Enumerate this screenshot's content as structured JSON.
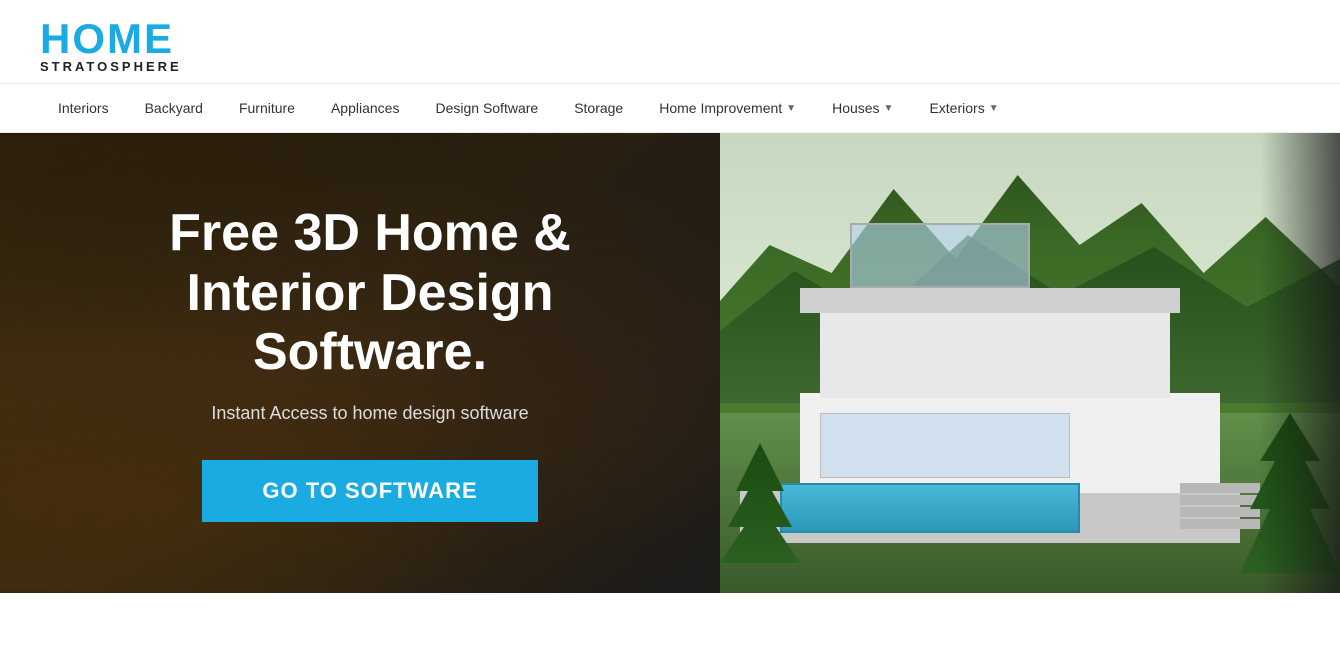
{
  "logo": {
    "home": "HOME",
    "stratosphere": "STRATOSPHERE"
  },
  "nav": {
    "items": [
      {
        "label": "Interiors",
        "hasDropdown": false
      },
      {
        "label": "Backyard",
        "hasDropdown": false
      },
      {
        "label": "Furniture",
        "hasDropdown": false
      },
      {
        "label": "Appliances",
        "hasDropdown": false
      },
      {
        "label": "Design Software",
        "hasDropdown": false
      },
      {
        "label": "Storage",
        "hasDropdown": false
      },
      {
        "label": "Home Improvement",
        "hasDropdown": true
      },
      {
        "label": "Houses",
        "hasDropdown": true
      },
      {
        "label": "Exteriors",
        "hasDropdown": true
      }
    ]
  },
  "hero": {
    "title": "Free 3D Home & Interior Design Software.",
    "subtitle": "Instant Access to home design software",
    "button_label": "GO TO SOFTWARE",
    "accent_color": "#1aabe3"
  }
}
